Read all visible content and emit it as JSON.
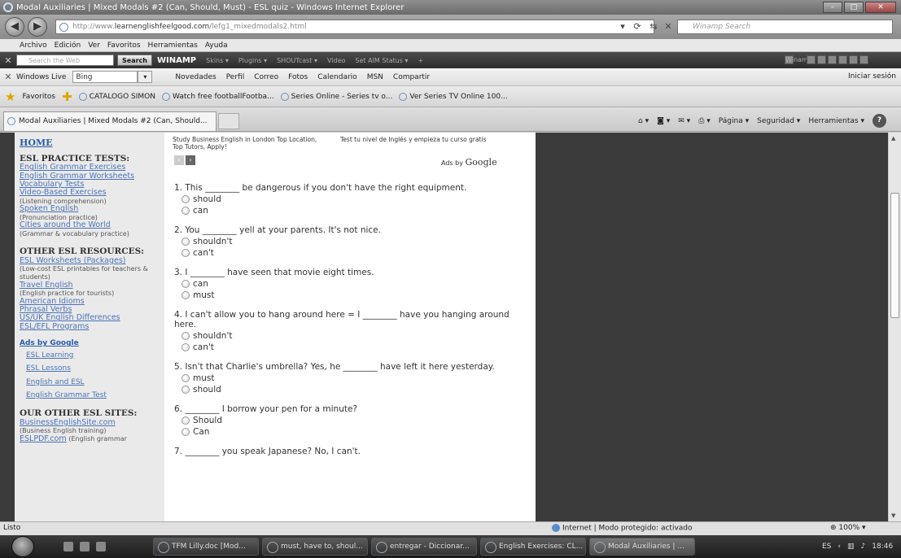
{
  "window": {
    "title": "Modal Auxiliaries | Mixed Modals #2 (Can, Should, Must) - ESL quiz - Windows Internet Explorer"
  },
  "address": {
    "prefix": "http://www.",
    "domain": "learnenglishfeelgood.com",
    "path": "/lefg1_mixedmodals2.html",
    "search_placeholder": "Winamp Search"
  },
  "menu": [
    "Archivo",
    "Edición",
    "Ver",
    "Favoritos",
    "Herramientas",
    "Ayuda"
  ],
  "winamp": {
    "search_placeholder": "Search the Web",
    "search_button": "Search",
    "brand": "WINAMP",
    "menus": [
      "Skins ▾",
      "Plugins ▾",
      "SHOUTcast ▾",
      "Video",
      "Set AIM Status ▾"
    ],
    "right_label": "Winam"
  },
  "live": {
    "label": "Windows Live",
    "search_value": "Bing",
    "links": [
      "Novedades",
      "Perfil",
      "Correo",
      "Fotos",
      "Calendario",
      "MSN",
      "Compartir"
    ],
    "signin": "Iniciar sesión"
  },
  "favorites": {
    "label": "Favoritos",
    "items": [
      "CATALOGO SIMON",
      "Watch free footballFootba...",
      "Series Online - Series tv o...",
      "Ver Series TV Online 100..."
    ]
  },
  "tab": {
    "title": "Modal Auxiliaries | Mixed Modals #2 (Can, Should..."
  },
  "commands": {
    "page": "Página ▾",
    "security": "Seguridad ▾",
    "tools": "Herramientas ▾",
    "help": "?"
  },
  "sidebar": {
    "home": "HOME",
    "practice_heading": "ESL PRACTICE TESTS:",
    "practice": [
      {
        "link": "English Grammar Exercises",
        "note": ""
      },
      {
        "link": "English Grammar Worksheets",
        "note": ""
      },
      {
        "link": "Vocabulary Tests",
        "note": ""
      },
      {
        "link": "Video-Based Exercises",
        "note": "(Listening comprehension)"
      },
      {
        "link": "Spoken English",
        "note": "(Pronunciation practice)"
      },
      {
        "link": "Cities around the World",
        "note": "(Grammar & vocabulary practice)"
      }
    ],
    "resources_heading": "OTHER ESL RESOURCES:",
    "resources": [
      {
        "link": "ESL Worksheets (Packages)",
        "note": "(Low-cost ESL printables for teachers & students)"
      },
      {
        "link": "Travel English",
        "note": "(English practice for tourists)"
      },
      {
        "link": "American Idioms",
        "note": ""
      },
      {
        "link": "Phrasal Verbs",
        "note": ""
      },
      {
        "link": "US/UK English Differences",
        "note": ""
      },
      {
        "link": "ESL/EFL Programs",
        "note": ""
      }
    ],
    "ads_heading": "Ads by Google",
    "ads": [
      "ESL Learning",
      "ESL Lessons",
      "English and ESL",
      "English Grammar Test"
    ],
    "sites_heading": "OUR OTHER ESL SITES:",
    "sites": [
      {
        "link": "BusinessEnglishSite.com",
        "note": "(Business English training)"
      },
      {
        "link": "ESLPDF.com",
        "note": "(English grammar"
      }
    ]
  },
  "ads": {
    "ad1": "Study Business English in London Top Location, Top Tutors, Apply!",
    "ad2": "Test tu nivel de Inglés y empieza tu curso gratis",
    "ads_by": "Ads by ",
    "google": "Google"
  },
  "questions": [
    {
      "text": "1. This ________ be dangerous if you don't have the right equipment.",
      "options": [
        "should",
        "can"
      ]
    },
    {
      "text": "2. You ________ yell at your parents. It's not nice.",
      "options": [
        "shouldn't",
        "can't"
      ]
    },
    {
      "text": "3. I ________ have seen that movie eight times.",
      "options": [
        "can",
        "must"
      ]
    },
    {
      "text": "4. I can't allow you to hang around here = I ________ have you hanging around here.",
      "options": [
        "shouldn't",
        "can't"
      ]
    },
    {
      "text": "5. Isn't that Charlie's umbrella? Yes, he ________ have left it here yesterday.",
      "options": [
        "must",
        "should"
      ]
    },
    {
      "text": "6. ________ I borrow your pen for a minute?",
      "options": [
        "Should",
        "Can"
      ]
    },
    {
      "text": "7. ________ you speak Japanese? No, I can't.",
      "options": []
    }
  ],
  "status": {
    "left": "Listo",
    "zone": "Internet | Modo protegido: activado",
    "zoom": "100%"
  },
  "taskbar": {
    "tasks": [
      "TFM Lilly.doc [Mod...",
      "must, have to, shoul...",
      "entregar - Diccionar...",
      "English Exercises: CL...",
      "Modal Auxiliaries | ..."
    ],
    "lang": "ES",
    "time": "18:46"
  }
}
